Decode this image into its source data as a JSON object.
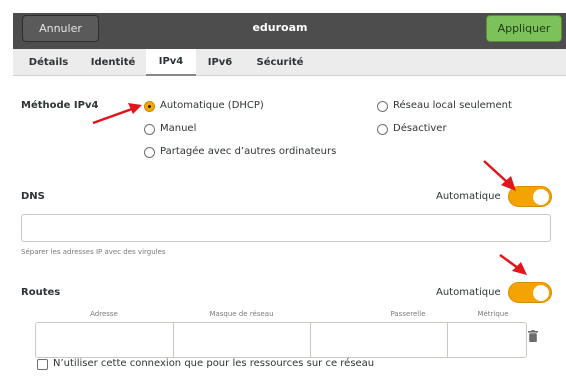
{
  "window": {
    "title": "eduroam",
    "cancel_label": "Annuler",
    "apply_label": "Appliquer"
  },
  "tabs": [
    {
      "label": "Détails"
    },
    {
      "label": "Identité"
    },
    {
      "label": "IPv4",
      "active": true
    },
    {
      "label": "IPv6"
    },
    {
      "label": "Sécurité"
    }
  ],
  "ipv4": {
    "method_label": "Méthode IPv4",
    "options": [
      {
        "label": "Automatique (DHCP)",
        "checked": true
      },
      {
        "label": "Manuel",
        "checked": false
      },
      {
        "label": "Partagée avec d’autres ordinateurs",
        "checked": false
      },
      {
        "label": "Réseau local seulement",
        "checked": false
      },
      {
        "label": "Désactiver",
        "checked": false
      }
    ]
  },
  "dns": {
    "label": "DNS",
    "auto_label": "Automatique",
    "auto_on": true,
    "input_value": "",
    "hint": "Séparer les adresses IP avec des virgules"
  },
  "routes": {
    "label": "Routes",
    "auto_label": "Automatique",
    "auto_on": true,
    "columns": [
      "Adresse",
      "Masque de réseau",
      "Passerelle",
      "Métrique"
    ]
  },
  "resources_only": {
    "label": "N’utiliser cette connexion que pour les ressources sur ce réseau",
    "checked": false
  },
  "colors": {
    "accent": "#f5a300",
    "apply": "#7cc15a",
    "headerbar": "#4d4d4d",
    "annotation_arrow": "#e0161b"
  },
  "icons": [
    "trash-icon"
  ]
}
